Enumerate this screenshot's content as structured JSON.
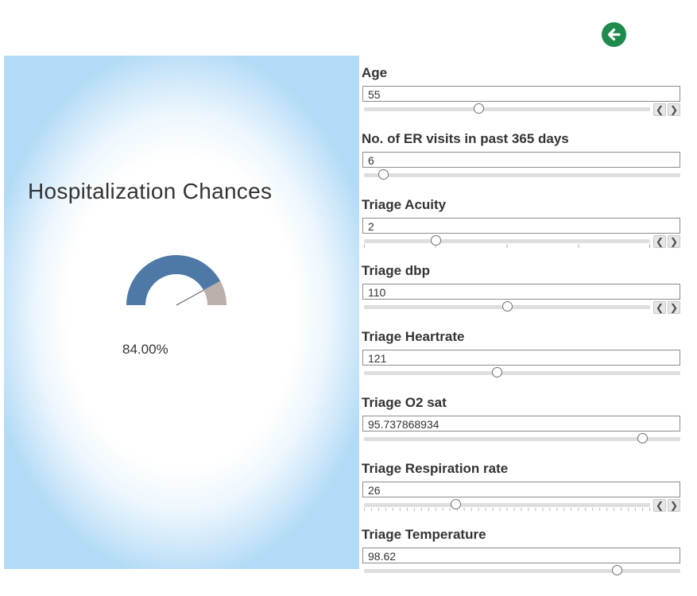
{
  "panel": {
    "title": "Hospitalization Chances",
    "value_text": "84.00%",
    "gauge_fraction": 0.84,
    "colors": {
      "filled": "#4e79a7",
      "remaining": "#bab0ac",
      "panel_edge": "#b3dbf6"
    }
  },
  "toolbar": {
    "back_icon": "arrow-left-circle-icon",
    "back_color": "#1e8a4c"
  },
  "controls": [
    {
      "label": "Age",
      "value": "55",
      "position": 0.4
    },
    {
      "label": "No. of ER visits in past 365 days",
      "value": "6",
      "position": 0.06
    },
    {
      "label": "Triage Acuity",
      "value": "2",
      "position": 0.25
    },
    {
      "label": "Triage dbp",
      "value": "110",
      "position": 0.5
    },
    {
      "label": "Triage Heartrate",
      "value": "121",
      "position": 0.42
    },
    {
      "label": "Triage O2 sat",
      "value": "95.737868934",
      "position": 0.88
    },
    {
      "label": "Triage Respiration rate",
      "value": "26",
      "position": 0.32
    },
    {
      "label": "Triage Temperature",
      "value": "98.62",
      "position": 0.8
    }
  ],
  "stepper": {
    "prev": "❮",
    "next": "❯"
  }
}
